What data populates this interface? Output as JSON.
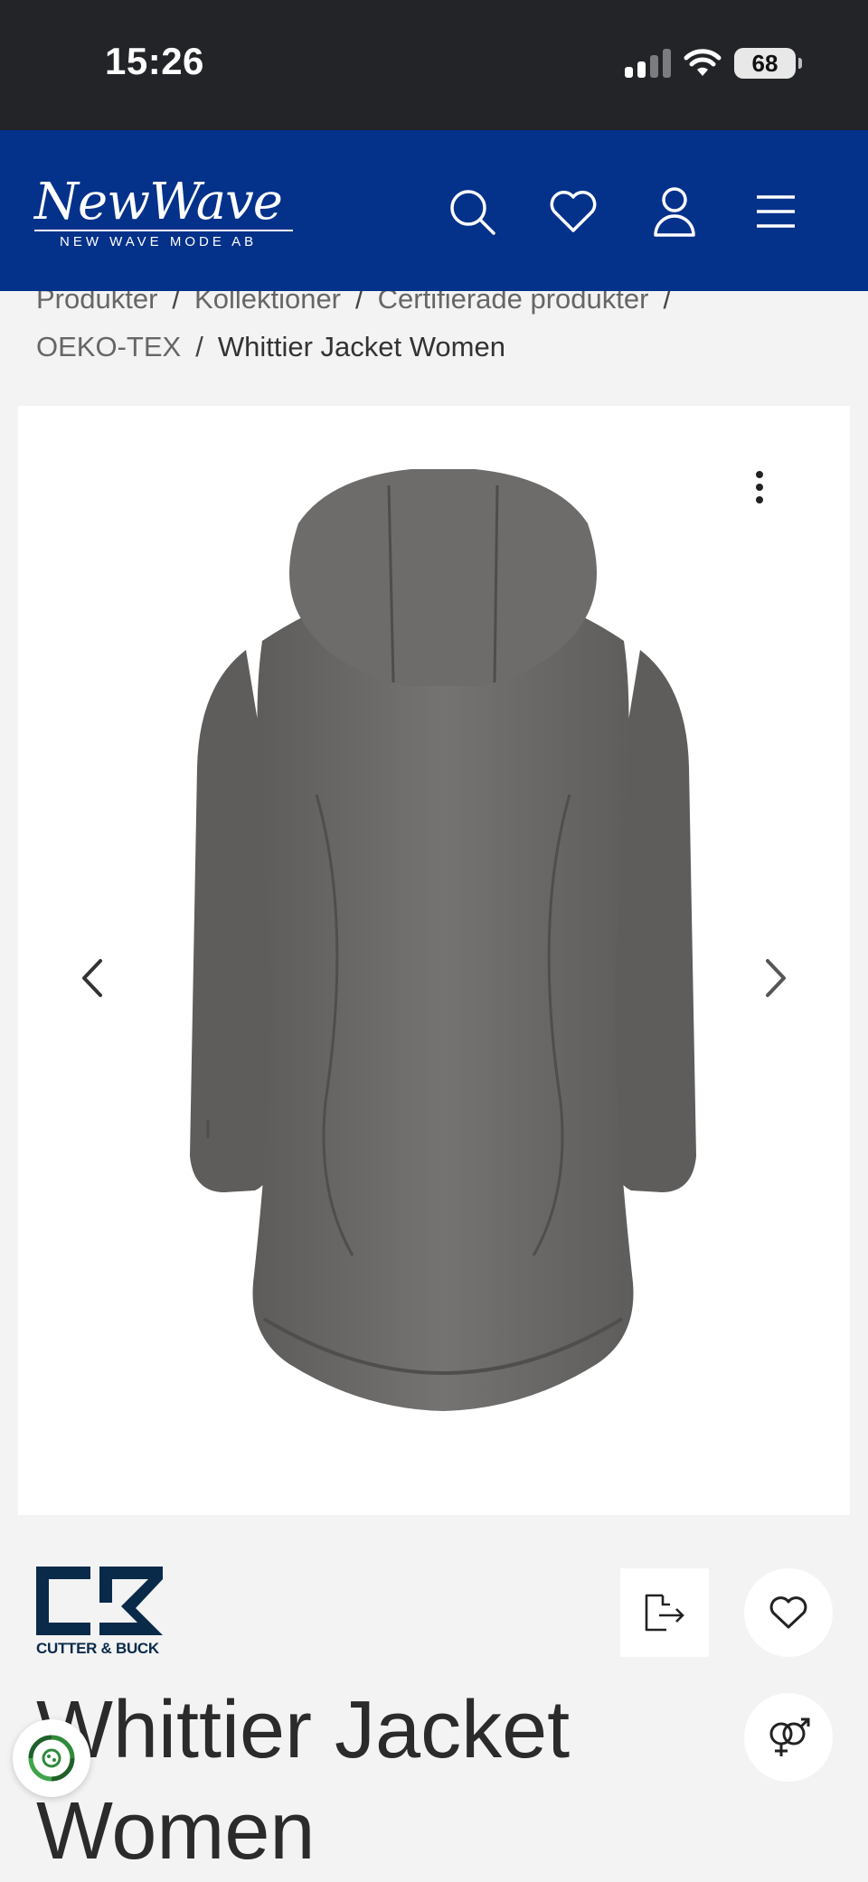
{
  "status_bar": {
    "time": "15:26",
    "battery": "68"
  },
  "header": {
    "logo_script": "NewWave",
    "logo_sub": "NEW WAVE MODE AB",
    "icons": [
      "search-icon",
      "heart-icon",
      "user-icon",
      "menu-icon"
    ]
  },
  "breadcrumb": {
    "items": [
      "Produkter",
      "Kollektioner",
      "Certifierade produkter",
      "OEKO-TEX"
    ],
    "current": "Whittier Jacket Women"
  },
  "product": {
    "brand": "CUTTER & BUCK",
    "title": "Whittier Jacket Women"
  },
  "colors": {
    "header_bg": "#04318a",
    "status_bg": "#222428",
    "page_bg": "#f3f3f3",
    "jacket": "#6b6a68"
  }
}
